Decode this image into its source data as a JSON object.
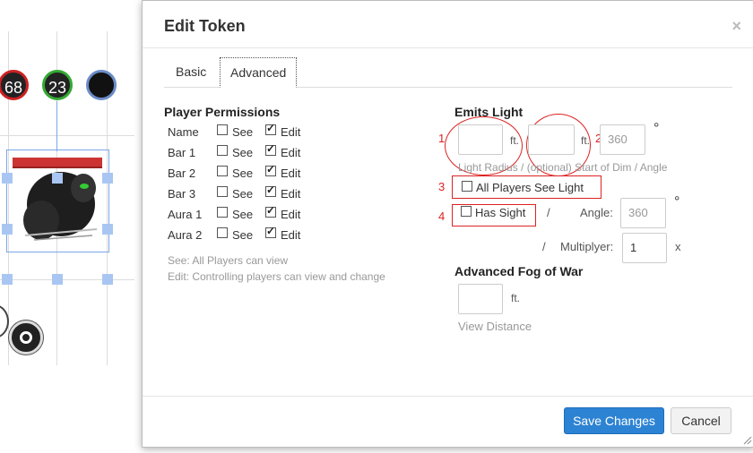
{
  "background": {
    "token_bubbles": [
      "68",
      "23",
      ""
    ]
  },
  "dialog": {
    "title": "Edit Token",
    "close_glyph": "×",
    "tabs": [
      {
        "label": "Basic",
        "active": false
      },
      {
        "label": "Advanced",
        "active": true
      }
    ],
    "player_permissions": {
      "heading": "Player Permissions",
      "see_label": "See",
      "edit_label": "Edit",
      "rows": [
        {
          "name": "Name",
          "see": false,
          "edit": true
        },
        {
          "name": "Bar 1",
          "see": false,
          "edit": true
        },
        {
          "name": "Bar 2",
          "see": false,
          "edit": true
        },
        {
          "name": "Bar 3",
          "see": false,
          "edit": true
        },
        {
          "name": "Aura 1",
          "see": false,
          "edit": true
        },
        {
          "name": "Aura 2",
          "see": false,
          "edit": true
        }
      ],
      "help_see": "See: All Players can view",
      "help_edit": "Edit: Controlling players can view and change"
    },
    "emits_light": {
      "heading": "Emits Light",
      "radius_value": "",
      "dim_start_value": "",
      "angle_placeholder": "360",
      "unit": "ft.",
      "degree_symbol": "°",
      "caption": "Light Radius / (optional) Start of Dim / Angle",
      "all_players_see_light_label": "All Players See Light",
      "all_players_see_light_checked": false
    },
    "sight": {
      "has_sight_label": "Has Sight",
      "has_sight_checked": false,
      "separator": "/",
      "angle_label": "Angle:",
      "angle_placeholder": "360",
      "multiplyer_separator": "/",
      "multiplyer_label": "Multiplyer:",
      "multiplyer_value": "1",
      "multiplyer_unit": "x"
    },
    "fog": {
      "heading": "Advanced Fog of War",
      "view_distance_value": "",
      "unit": "ft.",
      "caption": "View Distance"
    },
    "annotations": {
      "n1": "1",
      "n2": "2",
      "n3": "3",
      "n4": "4",
      "color": "#dd2222"
    },
    "buttons": {
      "save": "Save Changes",
      "cancel": "Cancel"
    }
  }
}
